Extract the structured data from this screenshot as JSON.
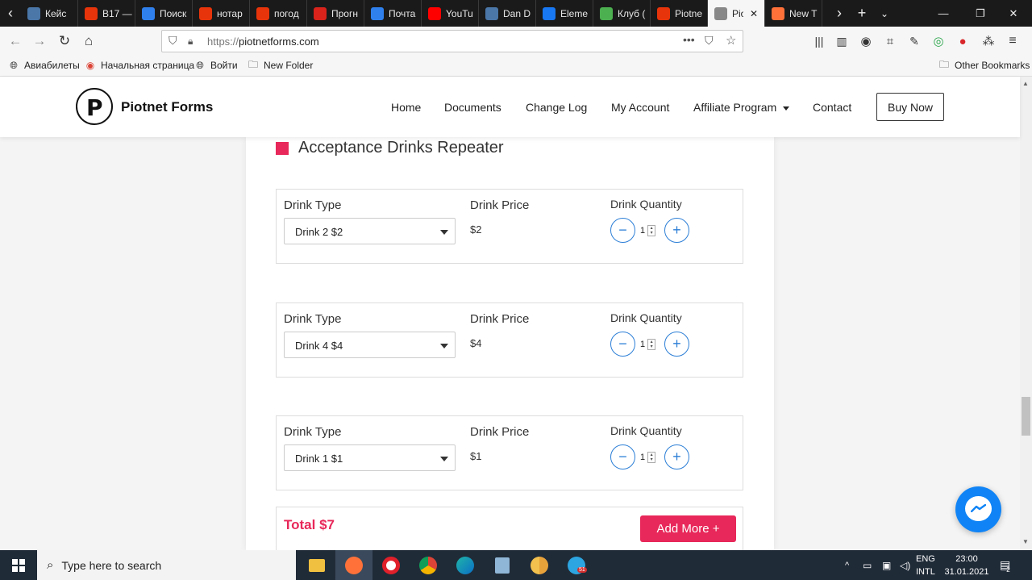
{
  "browser": {
    "tabs": [
      {
        "label": "Кейс",
        "icon": "vk-icon",
        "color": "#4a76a8"
      },
      {
        "label": "В17 —",
        "icon": "yandex-icon",
        "color": "#e8340a"
      },
      {
        "label": "Поиск",
        "icon": "mail-icon",
        "color": "#2f80ed"
      },
      {
        "label": "нотар",
        "icon": "yandex-icon",
        "color": "#e8340a"
      },
      {
        "label": "погод",
        "icon": "yandex-icon",
        "color": "#e8340a"
      },
      {
        "label": "Прогн",
        "icon": "umbrella-icon",
        "color": "#d9231b"
      },
      {
        "label": "Почта",
        "icon": "mail-icon",
        "color": "#2f80ed"
      },
      {
        "label": "YouTu",
        "icon": "youtube-icon",
        "color": "#ff0000"
      },
      {
        "label": "Dan D",
        "icon": "vk-icon",
        "color": "#4a76a8"
      },
      {
        "label": "Eleme",
        "icon": "facebook-icon",
        "color": "#1877f2"
      },
      {
        "label": "Клуб (",
        "icon": "chrome-icon",
        "color": "#4caf50"
      },
      {
        "label": "Piotne",
        "icon": "yandex-icon",
        "color": "#e8340a"
      },
      {
        "label": "Pio",
        "icon": "piotnet-icon",
        "color": "#888888",
        "active": true
      },
      {
        "label": "New T",
        "icon": "firefox-icon",
        "color": "#ff7139"
      }
    ],
    "url_proto": "https://",
    "url_host": "piotnetforms.com",
    "bookmarks": [
      {
        "label": "Авиабилеты",
        "icon": "globe-icon"
      },
      {
        "label": "Начальная страница",
        "icon": "chrome-icon"
      },
      {
        "label": "Войти",
        "icon": "globe-icon"
      },
      {
        "label": "New Folder",
        "icon": "folder-icon"
      }
    ],
    "other_bookmarks": "Other Bookmarks"
  },
  "site": {
    "brand": "Piotnet Forms",
    "menu": [
      "Home",
      "Documents",
      "Change Log",
      "My Account",
      "Affiliate Program",
      "Contact"
    ],
    "buy_now": "Buy Now"
  },
  "form": {
    "section_title": "Acceptance Drinks Repeater",
    "type_label": "Drink Type",
    "price_label": "Drink Price",
    "quantity_label": "Drink Quantity",
    "rows": [
      {
        "selected": "Drink 2 $2",
        "price": "$2",
        "quantity": "1"
      },
      {
        "selected": "Drink 4 $4",
        "price": "$4",
        "quantity": "1"
      },
      {
        "selected": "Drink 1 $1",
        "price": "$1",
        "quantity": "1"
      }
    ],
    "minus": "−",
    "plus": "+",
    "total": "Total $7",
    "add_more": "Add More +"
  },
  "taskbar": {
    "search_placeholder": "Type here to search",
    "lang_top": "ENG",
    "lang_bottom": "INTL",
    "time": "23:00",
    "date": "31.01.2021",
    "notif_count": "2",
    "telegram_badge": "51"
  },
  "colors": {
    "accent": "#e8285a",
    "qty_blue": "#2b7ed6",
    "messenger": "#1084f6"
  }
}
